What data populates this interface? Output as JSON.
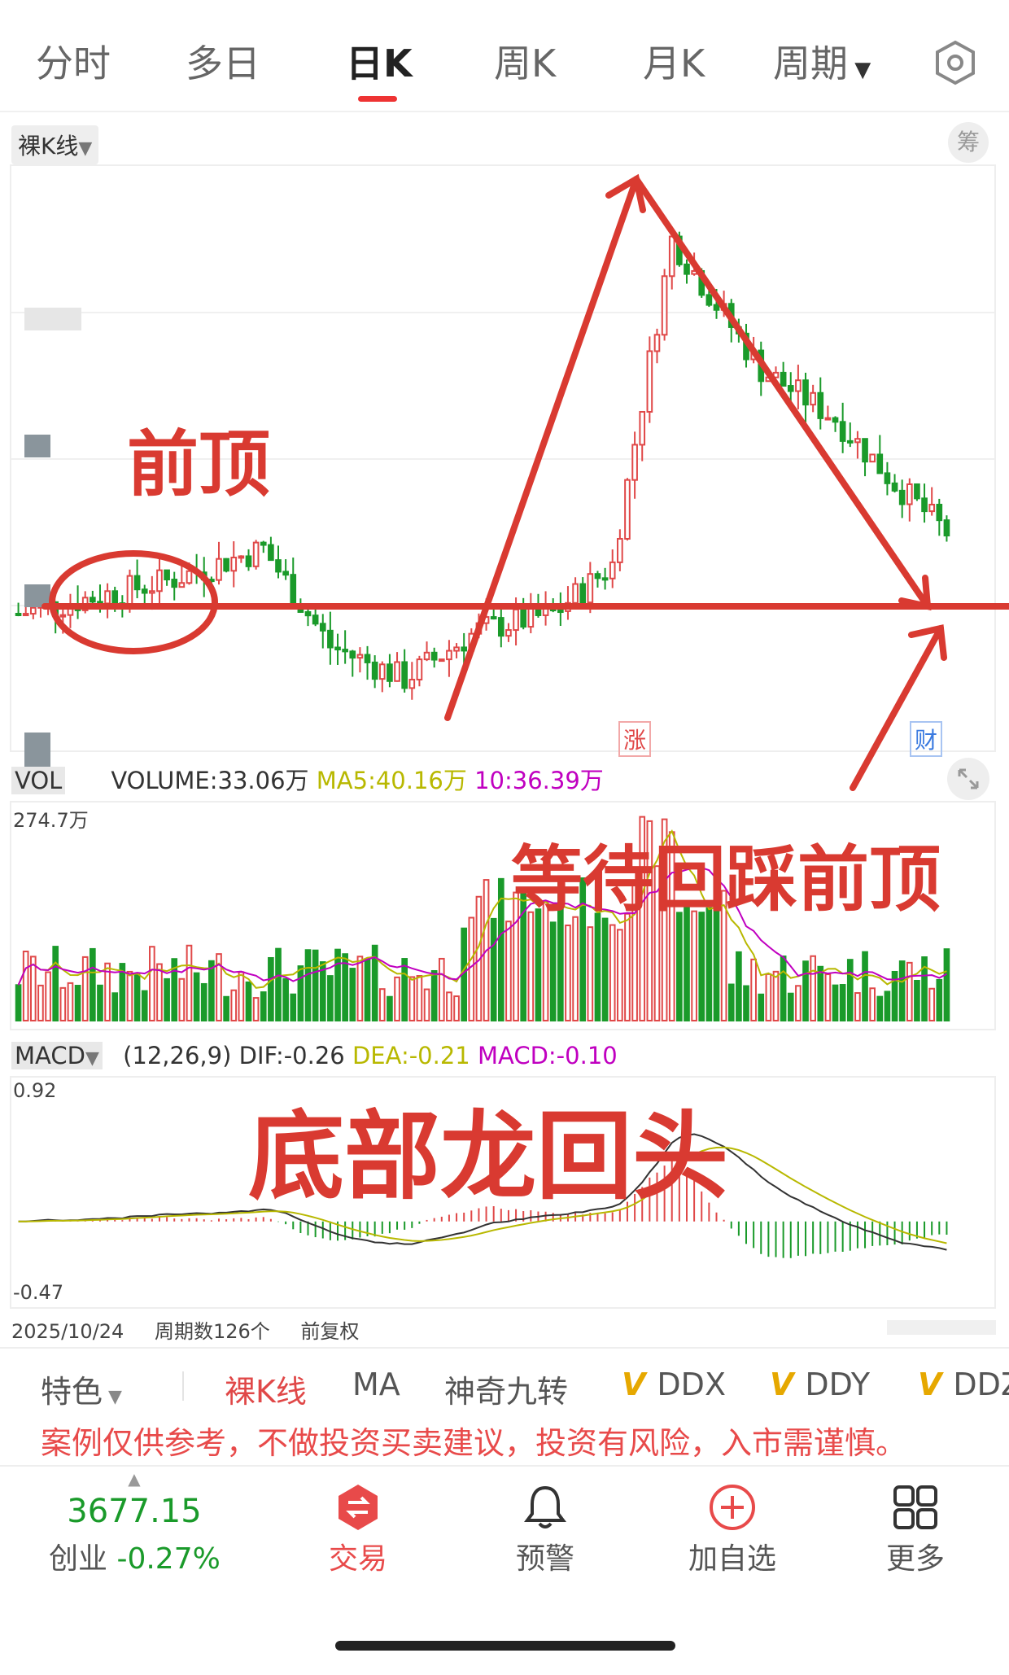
{
  "tabs": [
    "分时",
    "多日",
    "日K",
    "周K",
    "月K",
    "周期"
  ],
  "active_tab": "日K",
  "main_panel": {
    "selector": "裸K线",
    "chip_button": "筹",
    "badge_limit_up": "涨",
    "badge_finance": "财"
  },
  "volume_panel": {
    "selector": "VOL",
    "volume": "VOLUME:33.06万",
    "ma5": "MA5:40.16万",
    "ma10": "10:36.39万",
    "max_label": "274.7万"
  },
  "macd_panel": {
    "selector": "MACD",
    "params": "(12,26,9)",
    "dif": "DIF:-0.26",
    "dea": "DEA:-0.21",
    "macd": "MACD:-0.10",
    "ymax": "0.92",
    "ymin": "-0.47"
  },
  "footer_info": {
    "date": "2025/10/24",
    "periods": "周期数126个",
    "adjust": "前复权"
  },
  "toolbar": [
    "特色",
    "裸K线",
    "MA",
    "神奇九转",
    "DDX",
    "DDY",
    "DDZ"
  ],
  "toolbar_v": "V",
  "disclaimer": "案例仅供参考，不做投资买卖建议，投资有风险，入市需谨慎。",
  "index": {
    "value": "3677.15",
    "name": "创业",
    "change": "-0.27%"
  },
  "nav": [
    "交易",
    "预警",
    "加自选",
    "更多"
  ],
  "annotations": {
    "prev_top": "前顶",
    "wait": "等待回踩前顶",
    "title": "底部龙回头"
  },
  "colors": {
    "up": "#e04848",
    "down": "#1a9a2a",
    "annotation": "#d93a31",
    "ma5": "#b8b800",
    "ma10": "#c000c0"
  }
}
